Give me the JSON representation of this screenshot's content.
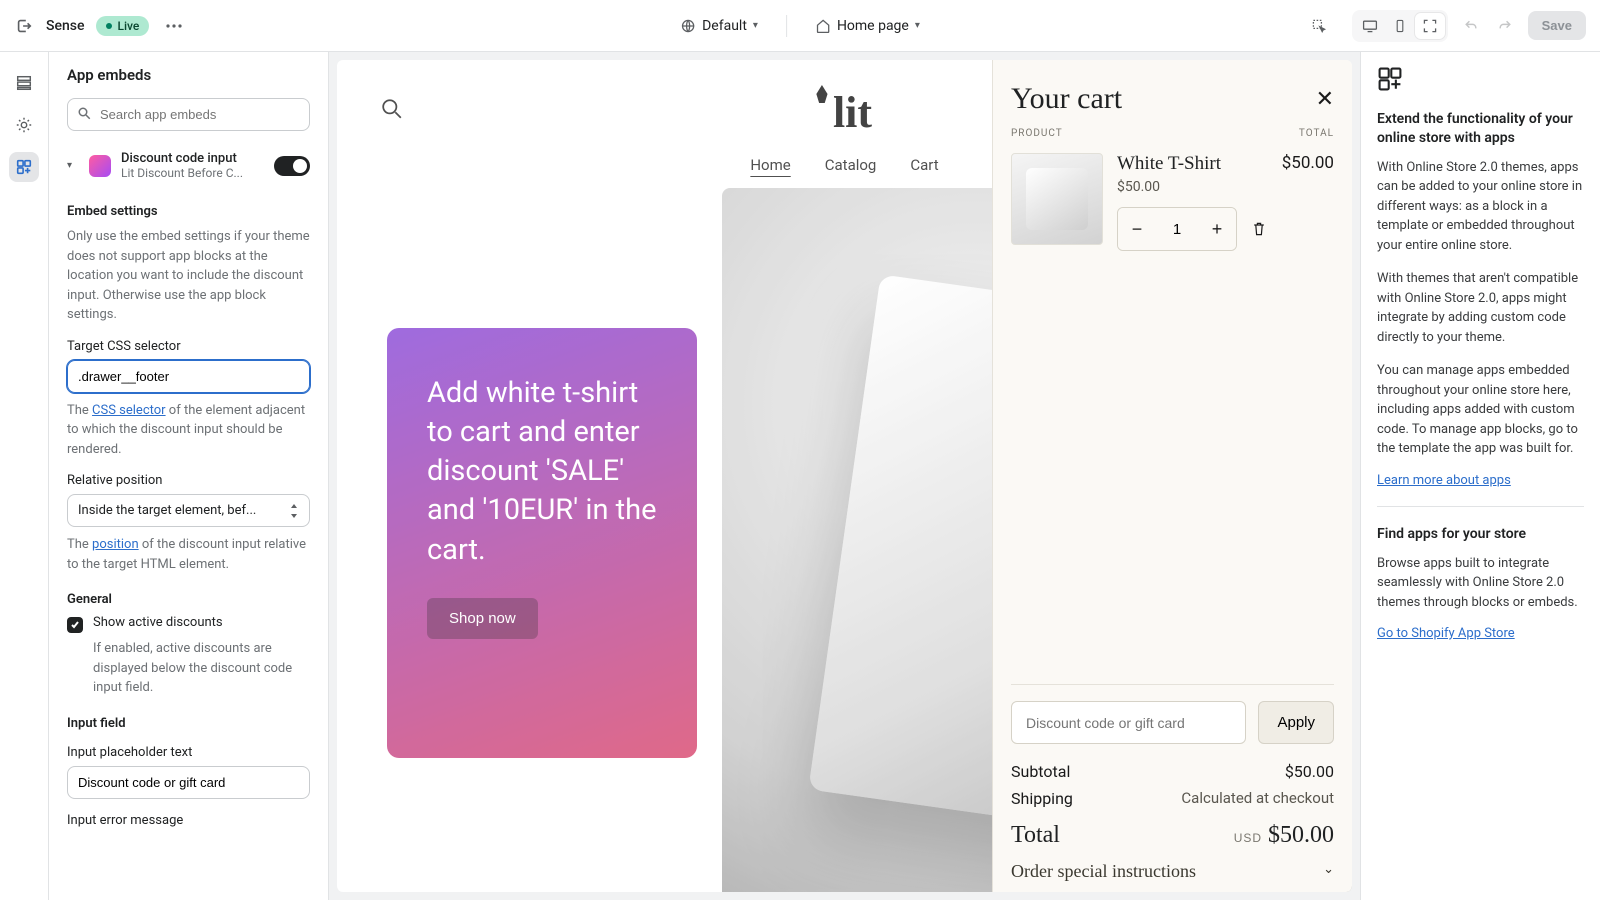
{
  "topbar": {
    "theme_name": "Sense",
    "live_badge": "Live",
    "context_label": "Default",
    "page_label": "Home page",
    "save_label": "Save"
  },
  "left_panel": {
    "title": "App embeds",
    "search_placeholder": "Search app embeds",
    "embed": {
      "title": "Discount code input",
      "subtitle": "Lit Discount Before C..."
    },
    "sections": {
      "embed_settings": "Embed settings",
      "general": "General",
      "input_field": "Input field"
    },
    "help": {
      "embed_settings": "Only use the embed settings if your theme does not support app blocks at the location you want to include the discount input. Otherwise use the app block settings.",
      "css_selector_before": "The ",
      "css_selector_link": "CSS selector",
      "css_selector_after": " of the element adjacent to which the discount input should be rendered.",
      "position_before": "The ",
      "position_link": "position",
      "position_after": " of the discount input relative to the target HTML element.",
      "show_active": "If enabled, active discounts are displayed below the discount code input field."
    },
    "fields": {
      "target_label": "Target CSS selector",
      "target_value": ".drawer__footer",
      "rel_pos_label": "Relative position",
      "rel_pos_value": "Inside the target element, bef...",
      "show_active_label": "Show active discounts",
      "placeholder_label": "Input placeholder text",
      "placeholder_value": "Discount code or gift card",
      "error_label": "Input error message"
    }
  },
  "store": {
    "logo": "lit",
    "nav": {
      "home": "Home",
      "catalog": "Catalog",
      "cart": "Cart"
    },
    "hero_text": "Add white t-shirt to cart and enter discount 'SALE' and '10EUR' in the cart.",
    "shop_now": "Shop now"
  },
  "cart": {
    "title": "Your cart",
    "col_product": "PRODUCT",
    "col_total": "TOTAL",
    "item": {
      "title": "White T-Shirt",
      "price": "$50.00",
      "line_total": "$50.00",
      "qty": "1"
    },
    "discount_placeholder": "Discount code or gift card",
    "apply_label": "Apply",
    "subtotal_label": "Subtotal",
    "subtotal_value": "$50.00",
    "shipping_label": "Shipping",
    "shipping_value": "Calculated at checkout",
    "total_label": "Total",
    "total_currency": "USD",
    "total_value": "$50.00",
    "special_label": "Order special instructions"
  },
  "right_panel": {
    "extend_title": "Extend the functionality of your online store with apps",
    "p1": "With Online Store 2.0 themes, apps can be added to your online store in different ways: as a block in a template or embedded throughout your entire online store.",
    "p2": "With themes that aren't compatible with Online Store 2.0, apps might integrate by adding custom code directly to your theme.",
    "p3": "You can manage apps embedded throughout your online store here, including apps added with custom code. To manage app blocks, go to the template the app was built for.",
    "learn_link": "Learn more about apps",
    "find_title": "Find apps for your store",
    "find_p": "Browse apps built to integrate seamlessly with Online Store 2.0 themes through blocks or embeds.",
    "store_link": "Go to Shopify App Store"
  }
}
